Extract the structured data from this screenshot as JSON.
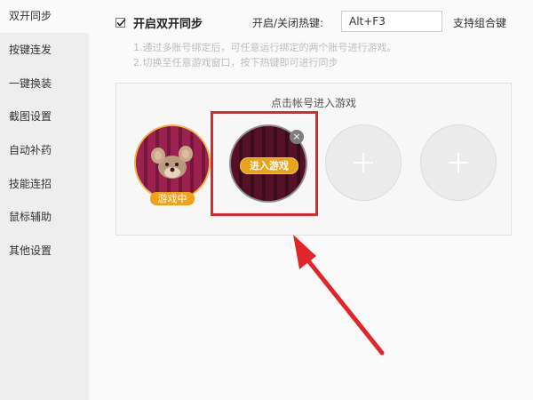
{
  "sidebar": {
    "items": [
      {
        "label": "双开同步",
        "active": true
      },
      {
        "label": "按键连发"
      },
      {
        "label": "一键换装"
      },
      {
        "label": "截图设置"
      },
      {
        "label": "自动补药"
      },
      {
        "label": "技能连招"
      },
      {
        "label": "鼠标辅助"
      },
      {
        "label": "其他设置"
      }
    ]
  },
  "sync": {
    "checkbox_label": "开启双开同步",
    "checked": true,
    "hotkey_label": "开启/关闭热键:",
    "hotkey_value": "Alt+F3",
    "combo_label": "支持组合键",
    "desc_line1": "1.通过多账号绑定后，可任意运行绑定的两个账号进行游戏。",
    "desc_line2": "2.切换至任意游戏窗口，按下热键即可进行同步"
  },
  "panel": {
    "title": "点击帐号进入游戏",
    "accounts": [
      {
        "status": "游戏中"
      },
      {
        "action": "进入游戏",
        "close": "×"
      }
    ],
    "add_slots": [
      "plus-icon",
      "plus-icon"
    ]
  },
  "colors": {
    "accent": "#f0a21a",
    "highlight": "#e0262a",
    "arrow": "#e0262a"
  }
}
